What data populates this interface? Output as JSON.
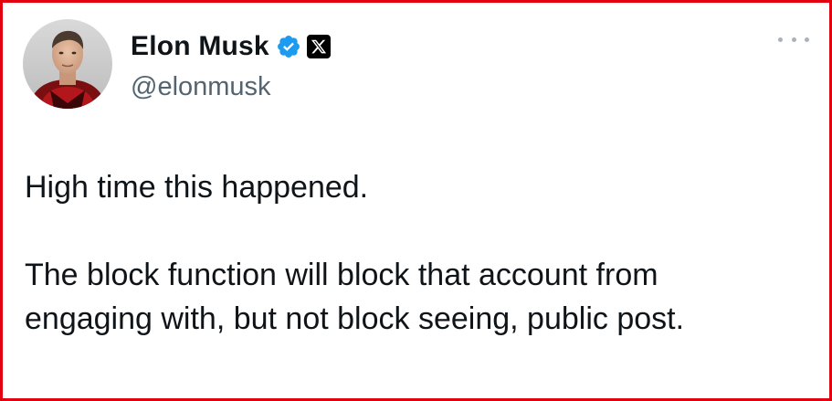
{
  "author": {
    "display_name": "Elon Musk",
    "handle": "@elonmusk",
    "avatar": "profile-photo",
    "verified_icon": "verified-badge-icon",
    "affiliation_icon": "x-logo-icon"
  },
  "menu": {
    "icon": "more-options-icon"
  },
  "tweet": {
    "paragraph_1": "High time this happened.",
    "paragraph_2": "The block function will block that account from\nengaging with, but not block seeing, public post."
  },
  "colors": {
    "frame_border": "#e3000f",
    "verified_blue": "#1d9bf0",
    "text_primary": "#0f1419",
    "text_secondary": "#536471"
  }
}
